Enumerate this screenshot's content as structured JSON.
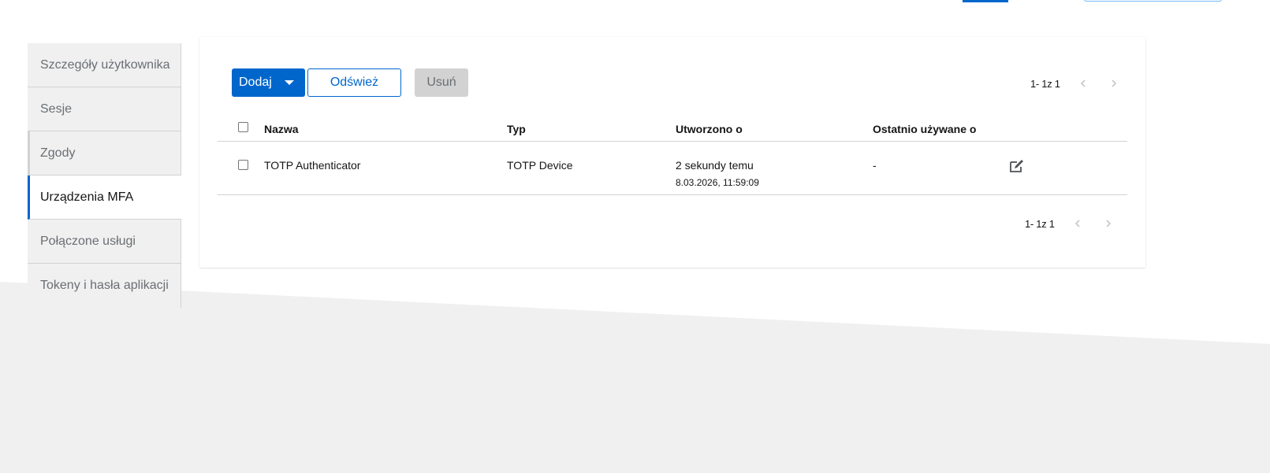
{
  "sidebar": {
    "items": [
      {
        "label": "Szczegóły użytkownika"
      },
      {
        "label": "Sesje"
      },
      {
        "label": "Zgody"
      },
      {
        "label": "Urządzenia MFA"
      },
      {
        "label": "Połączone usługi"
      },
      {
        "label": "Tokeny i hasła aplikacji"
      }
    ],
    "active_index": 3
  },
  "toolbar": {
    "add_label": "Dodaj",
    "refresh_label": "Odśwież",
    "delete_label": "Usuń"
  },
  "pagination": {
    "top_label": "1- 1z 1",
    "bottom_label": "1- 1z 1"
  },
  "table": {
    "columns": [
      "Nazwa",
      "Typ",
      "Utworzono o",
      "Ostatnio używane o"
    ],
    "rows": [
      {
        "name": "TOTP Authenticator",
        "type": "TOTP Device",
        "created_relative": "2 sekundy temu",
        "created_date": "8.03.2026, 11:59:09",
        "last_used": "-"
      }
    ]
  },
  "icons": {
    "add_caret": "caret-down-icon",
    "prev": "chevron-left-icon",
    "next": "chevron-right-icon",
    "edit": "edit-icon"
  },
  "colors": {
    "primary": "#0066cc",
    "disabled_bg": "#d2d2d2",
    "nav_bg": "#f0f0f0",
    "page_bg_shape": "#f0f0f0"
  }
}
